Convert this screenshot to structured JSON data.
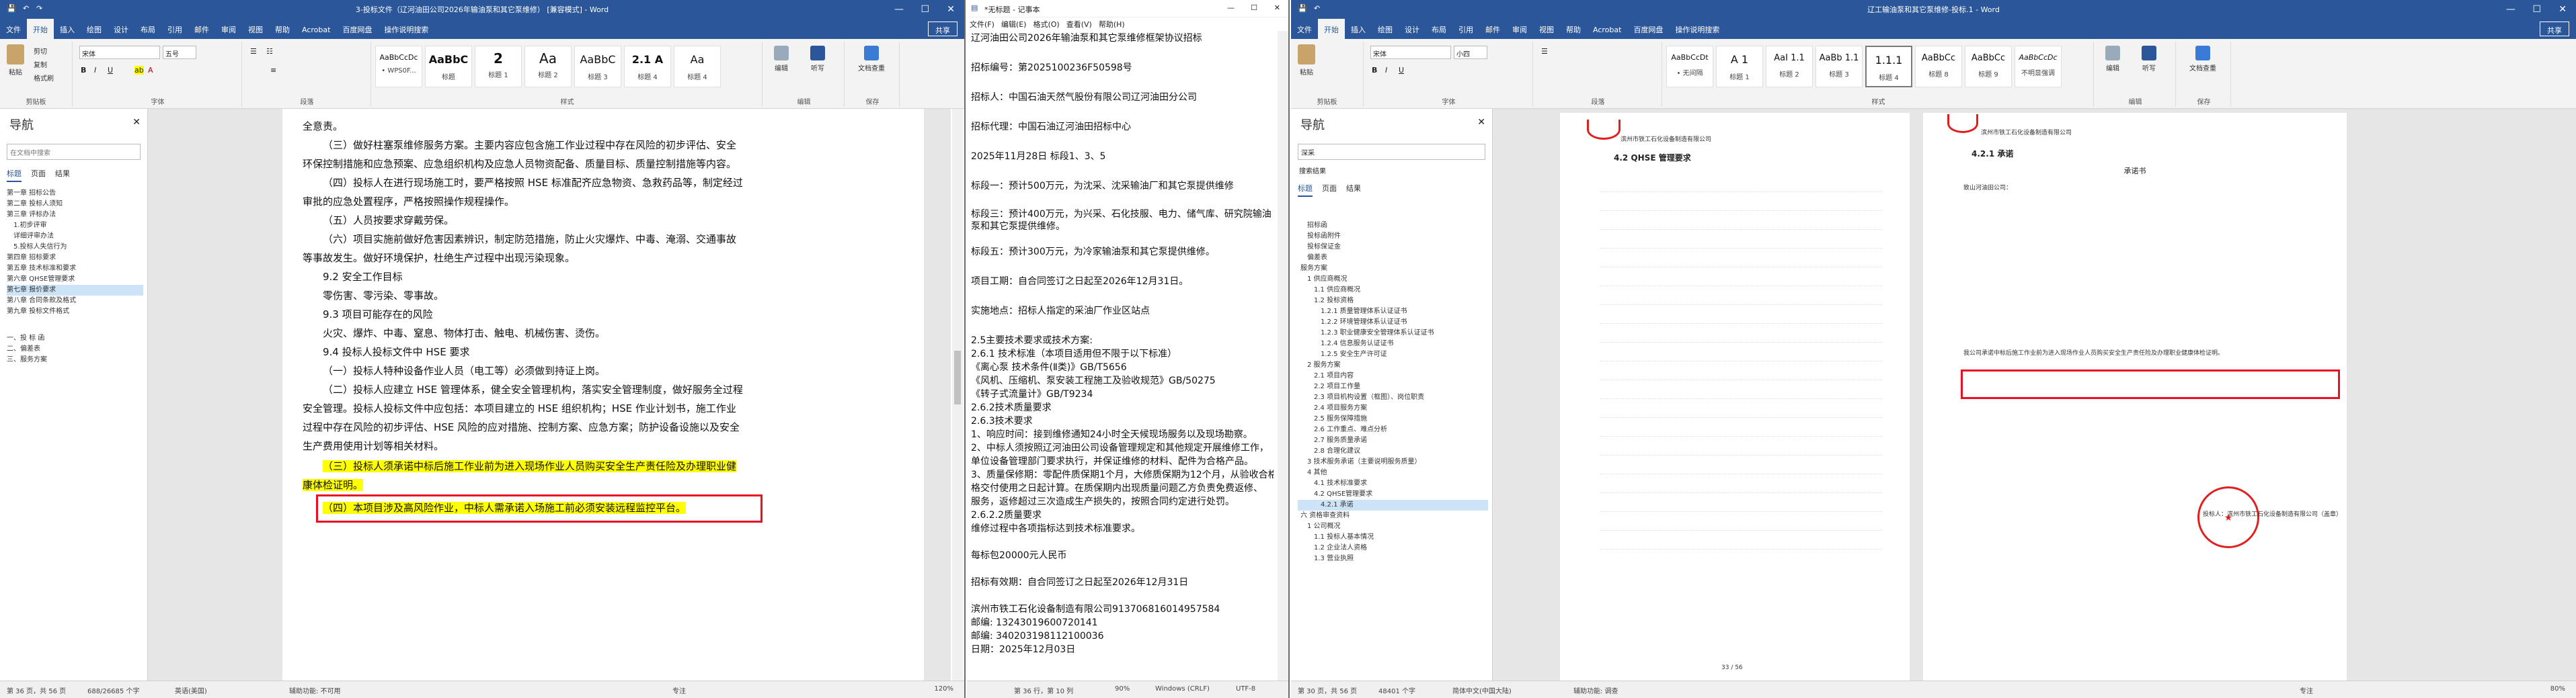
{
  "colors": {
    "word_blue": "#2b579a",
    "highlight": "#ffff00",
    "red_box": "#e81123",
    "seal_red": "#e02020"
  },
  "left_word": {
    "title": "3-投标文件（辽河油田公司2026年输油泵和其它泵维修） [兼容模式] - Word",
    "share": "共享",
    "tabs": [
      "文件",
      "开始",
      "插入",
      "绘图",
      "设计",
      "布局",
      "引用",
      "邮件",
      "审阅",
      "视图",
      "帮助",
      "Acrobat",
      "百度网盘",
      "操作说明搜索"
    ],
    "ribbon": {
      "clipboard_group": "剪贴板",
      "paste": "粘贴",
      "cut": "剪切",
      "copy": "复制",
      "format_painter": "格式刷",
      "font_group": "字体",
      "font_name": "宋体",
      "font_size": "五号",
      "paragraph_group": "段落",
      "styles_group": "样式",
      "editing_group": "编辑",
      "styles": [
        {
          "sample": "AaBbCcDc",
          "name": "• WPS0F..."
        },
        {
          "sample": "AaBbC",
          "name": "标题"
        },
        {
          "sample": "2",
          "name": "标题 1"
        },
        {
          "sample": "Aa",
          "name": "标题 2"
        },
        {
          "sample": "AaBbC",
          "name": "标题 3"
        },
        {
          "sample": "2.1 A",
          "name": "标题 4"
        },
        {
          "sample": "Aa",
          "name": "标题 4"
        }
      ],
      "editing": "编辑",
      "dictate": "听写",
      "check": "文档查重",
      "save_group": "保存"
    },
    "nav": {
      "title": "导航",
      "search_placeholder": "在文档中搜索",
      "tabs": [
        "标题",
        "页面",
        "结果"
      ],
      "items": [
        "第一章  招标公告",
        "第二章  投标人须知",
        "第三章  评标办法",
        "1.初步评审",
        "详细评审办法",
        "5.投标人失信行为",
        "第四章  招标要求",
        "第五章  技术标准和要求",
        "第六章  QHSE管理要求",
        "第七章  报价要求",
        "第八章  合同条款及格式",
        "第九章  投标文件格式",
        "一、投 标 函",
        "二、偏差表",
        "三、服务方案"
      ],
      "selected": 9
    },
    "doc": {
      "lines": [
        "全意责。",
        "（三）做好柱塞泵维修服务方案。主要内容应包含施工作业过程中存在风险的初步评估、安全",
        "环保控制措施和应急预案、应急组织机构及应急人员物资配备、质量目标、质量控制措施等内容。",
        "（四）投标人在进行现场施工时，要严格按照 HSE 标准配齐应急物资、急救药品等，制定经过",
        "审批的应急处置程序，严格按照操作规程操作。",
        "（五）人员按要求穿戴劳保。",
        "（六）项目实施前做好危害因素辨识，制定防范措施，防止火灾爆炸、中毒、淹溺、交通事故",
        "等事故发生。做好环境保护，杜绝生产过程中出现污染现象。",
        "9.2 安全工作目标",
        "零伤害、零污染、零事故。",
        "9.3 项目可能存在的风险",
        "火灾、爆炸、中毒、窒息、物体打击、触电、机械伤害、烫伤。",
        "9.4 投标人投标文件中 HSE 要求",
        "（一）投标人特种设备作业人员（电工等）必须做到持证上岗。",
        "（二）投标人应建立 HSE 管理体系，健全安全管理机构，落实安全管理制度，做好服务全过程",
        "安全管理。投标人投标文件中应包括：本项目建立的 HSE 组织机构；HSE 作业计划书，施工作业",
        "过程中存在风险的初步评估、HSE 风险的应对措施、控制方案、应急方案；防护设备设施以及安全",
        "生产费用使用计划等相关材料。"
      ],
      "highlight_1a": "（三）投标人须承诺中标后施工作业前为进入现场作业人员购买安全生产责任险及办理职业健",
      "highlight_1b": "康体检证明。",
      "highlight_2": "（四）本项目涉及高风险作业，中标人需承诺入场施工前必须安装远程监控平台。"
    },
    "status": {
      "page": "第 36 页，共 56 页",
      "words": "688/26685 个字",
      "lang": "英语(美国)",
      "access": "辅助功能: 不可用",
      "focus": "专注",
      "zoom": "120%"
    }
  },
  "notepad": {
    "title": "*无标题 - 记事本",
    "menu": [
      "文件(F)",
      "编辑(E)",
      "格式(O)",
      "查看(V)",
      "帮助(H)"
    ],
    "lines": [
      "辽河油田公司2026年输油泵和其它泵维修框架协议招标",
      "",
      "招标编号：第2025100236F50598号",
      "",
      "招标人：中国石油天然气股份有限公司辽河油田分公司",
      "",
      "招标代理：中国石油辽河油田招标中心",
      "",
      "2025年11月28日   标段1、3、5",
      "",
      "标段一：预计500万元，为沈采、沈采输油厂和其它泵提供维修",
      "",
      "标段三：预计400万元，为兴采、石化技服、电力、储气库、研究院输油泵和其它泵提供维修。",
      "",
      "标段五：预计300万元，为冷家输油泵和其它泵提供维修。",
      "",
      "项目工期：自合同签订之日起至2026年12月31日。",
      "",
      "实施地点：招标人指定的采油厂作业区站点",
      "",
      "2.5主要技术要求或技术方案:",
      "2.6.1 技术标准（本项目适用但不限于以下标准）",
      "《离心泵 技术条件(Ⅱ类)》GB/T5656",
      "《风机、压缩机、泵安装工程施工及验收规范》GB/50275",
      "《转子式流量计》GB/T9234",
      "2.6.2技术质量要求",
      "2.6.3技术要求",
      "1、响应时间：接到维修通知24小时全天候现场服务以及现场勘察。",
      "2、中标人须按照辽河油田公司设备管理规定和其他规定开展维修工作，",
      "单位设备管理部门要求执行，并保证维修的材料、配件为合格产品。",
      "3、质量保修期：零配件质保期1个月，大修质保期为12个月，从验收合格",
      "格交付使用之日起计算。在质保期内出现质量问题乙方负责免费返修、",
      "服务，返修超过三次造成生产损失的，按照合同约定进行处罚。",
      "2.6.2.2质量要求",
      "维修过程中各项指标达到技术标准要求。",
      "",
      "每标包20000元人民币",
      "",
      "招标有效期：自合同签订之日起至2026年12月31日",
      "",
      "滨州市铁工石化设备制造有限公司913706816014957584",
      "邮编: 13243019600720141",
      "邮编: 340203198112100036",
      "日期：2025年12月03日"
    ],
    "status": {
      "pos": "第 36 行，第 10 列",
      "zoom": "90%",
      "eol": "Windows (CRLF)",
      "enc": "UTF-8"
    }
  },
  "right_word": {
    "title": "辽工输油泵和其它泵维修-投标.1 - Word",
    "share": "共享",
    "tabs": [
      "文件",
      "开始",
      "插入",
      "绘图",
      "设计",
      "布局",
      "引用",
      "邮件",
      "审阅",
      "视图",
      "帮助",
      "Acrobat",
      "百度网盘",
      "操作说明搜索"
    ],
    "ribbon": {
      "font_name": "宋体",
      "font_size": "小四",
      "styles": [
        {
          "sample": "AaBbCcDt",
          "name": "• 无间隔"
        },
        {
          "sample": "A 1",
          "name": "标题 1"
        },
        {
          "sample": "AaI 1.1",
          "name": "标题 2"
        },
        {
          "sample": "AaBb 1.1",
          "name": "标题 3"
        },
        {
          "sample": "1.1.1",
          "name": "标题 4"
        },
        {
          "sample": "AaBbCc",
          "name": "标题 8"
        },
        {
          "sample": "AaBbCc",
          "name": "标题 9"
        },
        {
          "sample": "AaBbCcDc",
          "name": "不明显强调"
        }
      ],
      "editing": "编辑",
      "dictate": "听写",
      "check": "文档查重"
    },
    "nav": {
      "title": "导航",
      "search_value": "深采",
      "results": "搜索结果",
      "tabs": [
        "标题",
        "页面",
        "结果"
      ],
      "items": [
        "招标函",
        "投标函附件",
        "投标保证金",
        "偏差表",
        "服务方案",
        "1 供应商概况",
        "1.1 供应商概况",
        "1.2 投标资格",
        "1.2.1 质量管理体系认证证书",
        "1.2.2 环境管理体系认证证书",
        "1.2.3 职业健康安全管理体系认证证书",
        "1.2.4 信息服务认证证书",
        "1.2.5 安全生产许可证",
        "2 服务方案",
        "2.1 项目内容",
        "2.2 项目工作量",
        "2.3 项目机构设置（框图）、岗位职责",
        "2.4 项目服务方案",
        "2.5 服务保障措施",
        "2.6 工作重点、难点分析",
        "2.7 服务质量承诺",
        "2.8 合理化建议",
        "3 技术服务承诺（主要说明服务质量）",
        "4 其他",
        "4.1 技术标准要求",
        "4.2 QHSE管理要求",
        "4.2.1 承诺",
        "六 资格审查资料",
        "1 公司概况",
        "1.1 投标人基本情况",
        "1.2 企业法人资格",
        "1.3 营业执照"
      ],
      "selected": 26
    },
    "doc": {
      "left_heading": "4.2  QHSE 管理要求",
      "left_header": "滨州市铁工石化设备制造有限公司",
      "right_heading": "4.2.1  承诺",
      "right_header": "滨州市铁工石化设备制造有限公司",
      "letter_title": "承诺书",
      "letter_to": "致山河油田公司：",
      "commit_line": "我公司承诺中标后施工作业前为进入现场作业人员购买安全生产责任险及办理职业健康体检证明。",
      "seal_text": "滨州市铁工石化设备制造有限公司",
      "sign_label": "投标人：滨州市铁工石化设备制造有限公司（盖章）",
      "page_no_left": "33 / 56"
    },
    "status": {
      "page": "第 30 页，共 56 页",
      "words": "48401 个字",
      "lang": "简体中文(中国大陆)",
      "access": "辅助功能: 调查",
      "focus": "专注",
      "zoom": "80%"
    }
  }
}
